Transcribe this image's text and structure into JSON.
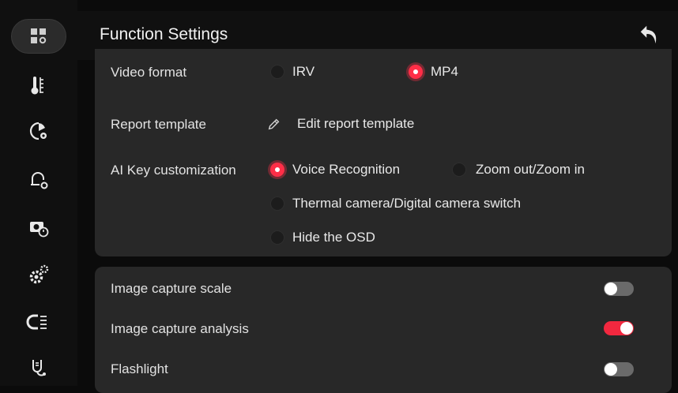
{
  "header": {
    "title": "Function Settings"
  },
  "sidebar": {
    "items": [
      {
        "icon": "settings-grid-icon",
        "active": true
      },
      {
        "icon": "thermometer-icon"
      },
      {
        "icon": "palette-settings-icon"
      },
      {
        "icon": "alarm-settings-icon"
      },
      {
        "icon": "camera-timer-icon"
      },
      {
        "icon": "gears-icon"
      },
      {
        "icon": "image-analysis-icon"
      },
      {
        "icon": "stethoscope-icon"
      }
    ]
  },
  "video_format": {
    "label": "Video format",
    "options": [
      {
        "label": "IRV",
        "selected": false
      },
      {
        "label": "MP4",
        "selected": true
      }
    ]
  },
  "report_template": {
    "label": "Report template",
    "action": "Edit report template"
  },
  "ai_key": {
    "label": "AI Key customization",
    "options": [
      {
        "label": "Voice Recognition",
        "selected": true
      },
      {
        "label": "Zoom out/Zoom in",
        "selected": false
      },
      {
        "label": "Thermal camera/Digital camera switch",
        "selected": false
      },
      {
        "label": "Hide the OSD",
        "selected": false
      }
    ]
  },
  "toggles": [
    {
      "label": "Image capture scale",
      "on": false
    },
    {
      "label": "Image capture analysis",
      "on": true
    },
    {
      "label": "Flashlight",
      "on": false
    }
  ],
  "colors": {
    "accent": "#ff2e47",
    "card": "#282828",
    "background": "#0b0b0b"
  }
}
